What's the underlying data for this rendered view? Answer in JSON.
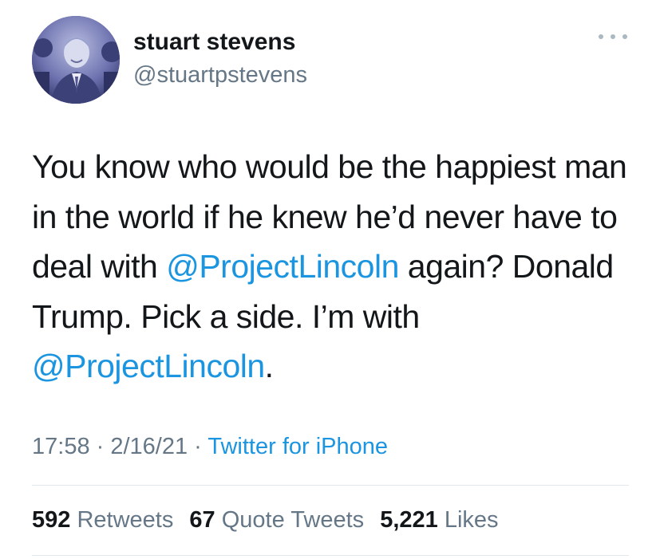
{
  "user": {
    "display_name": "stuart stevens",
    "handle": "@stuartpstevens"
  },
  "tweet": {
    "segments": [
      {
        "text": "You know who would be the happiest man in the world if he knew he’d never have to deal with ",
        "type": "text"
      },
      {
        "text": "@ProjectLincoln",
        "type": "mention"
      },
      {
        "text": " again? Donald Trump. Pick a side. I’m with ",
        "type": "text"
      },
      {
        "text": "@ProjectLincoln",
        "type": "mention"
      },
      {
        "text": ".",
        "type": "text"
      }
    ]
  },
  "meta": {
    "time": "17:58",
    "separator": " · ",
    "date": "2/16/21",
    "source": "Twitter for iPhone"
  },
  "stats": {
    "retweets_count": "592",
    "retweets_label": "Retweets",
    "quotes_count": "67",
    "quotes_label": "Quote Tweets",
    "likes_count": "5,221",
    "likes_label": "Likes"
  },
  "icons": {
    "more": "more-horizontal-icon",
    "avatar": "profile-photo"
  },
  "colors": {
    "mention": "#1b95e0",
    "secondary_text": "#657786",
    "primary_text": "#14171a",
    "divider": "#e1e8ed"
  }
}
